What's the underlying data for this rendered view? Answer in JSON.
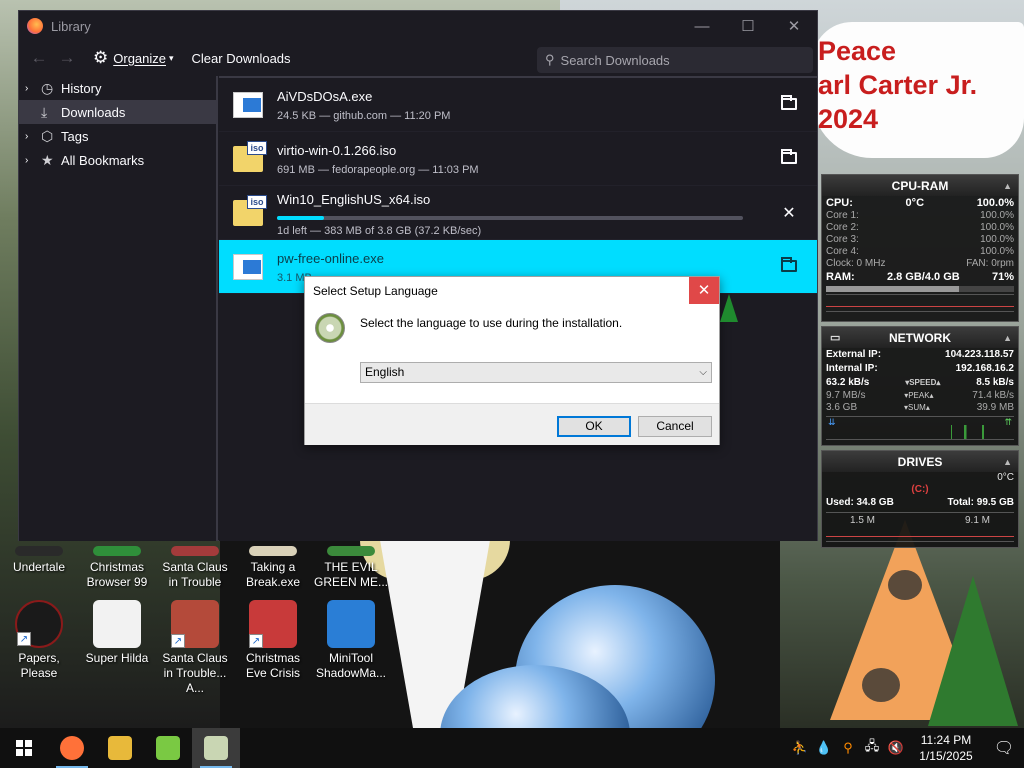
{
  "sticker": {
    "lines": [
      "Peace",
      "arl Carter Jr.",
      "2024"
    ]
  },
  "desktop_icons": [
    {
      "label": "Undertale",
      "color": "#2a2a2a",
      "shortcut": true
    },
    {
      "label": "Christmas Browser 99",
      "color": "#2f8f3a",
      "shortcut": true
    },
    {
      "label": "Santa Claus in Trouble",
      "color": "#a33b3b",
      "shortcut": true
    },
    {
      "label": "Taking a Break.exe",
      "color": "#d9d1b8",
      "shortcut": false
    },
    {
      "label": "THE EVIL GREEN ME...",
      "color": "#3b8a3b",
      "shortcut": true
    },
    {
      "label": "Papers, Please",
      "color": "#8a1a1a",
      "shortcut": true
    },
    {
      "label": "Super Hilda",
      "color": "#f2f2f2",
      "shortcut": false
    },
    {
      "label": "Santa Claus in Trouble... A...",
      "color": "#b44a3a",
      "shortcut": true
    },
    {
      "label": "Christmas Eve Crisis",
      "color": "#c83a3a",
      "shortcut": true
    },
    {
      "label": "MiniTool ShadowMa...",
      "color": "#2a7ed6",
      "shortcut": false
    }
  ],
  "library": {
    "title": "Library",
    "toolbar": {
      "back": "←",
      "forward": "→",
      "organize": "Organize",
      "clear": "Clear Downloads"
    },
    "search_placeholder": "Search Downloads",
    "sidebar": [
      {
        "label": "History",
        "twisty": "›",
        "icon": "◷"
      },
      {
        "label": "Downloads",
        "twisty": "",
        "icon": "⤓"
      },
      {
        "label": "Tags",
        "twisty": "›",
        "icon": "⬡"
      },
      {
        "label": "All Bookmarks",
        "twisty": "›",
        "icon": "★"
      }
    ],
    "downloads": [
      {
        "name": "AiVDsDOsA.exe",
        "status": "24.5 KB — github.com — 11:20 PM",
        "type": "exe"
      },
      {
        "name": "virtio-win-0.1.266.iso",
        "status": "691 MB — fedorapeople.org — 11:03 PM",
        "type": "iso"
      },
      {
        "name": "Win10_EnglishUS_x64.iso",
        "status": "1d left — 383 MB of 3.8 GB (37.2 KB/sec)",
        "type": "iso",
        "progress": 0.1
      },
      {
        "name": "pw-free-online.exe",
        "status": "3.1 MB",
        "type": "exe"
      }
    ]
  },
  "setup_dialog": {
    "title": "Select Setup Language",
    "close": "✕",
    "message": "Select the language to use during the installation.",
    "selected_language": "English",
    "ok": "OK",
    "cancel": "Cancel"
  },
  "gadgets": {
    "cpu_ram": {
      "title": "CPU-RAM",
      "cpu_label": "CPU:",
      "cpu_temp": "0°C",
      "cpu_value": "100.0%",
      "cores": [
        {
          "label": "Core 1:",
          "value": "100.0%"
        },
        {
          "label": "Core 2:",
          "value": "100.0%"
        },
        {
          "label": "Core 3:",
          "value": "100.0%"
        },
        {
          "label": "Core 4:",
          "value": "100.0%"
        }
      ],
      "clock": "Clock: 0 MHz",
      "fan": "FAN: 0rpm",
      "ram_label": "RAM:",
      "ram_value": "2.8 GB/4.0 GB",
      "ram_pct": "71%",
      "ram_fill": 0.71
    },
    "network": {
      "title": "NETWORK",
      "external_label": "External IP:",
      "external_ip": "104.223.118.57",
      "internal_label": "Internal IP:",
      "internal_ip": "192.168.16.2",
      "rows": [
        {
          "down": "63.2 kB/s",
          "label": "SPEED",
          "up": "8.5 kB/s"
        },
        {
          "down": "9.7 MB/s",
          "label": "PEAK",
          "up": "71.4 kB/s"
        },
        {
          "down": "3.6 GB",
          "label": "SUM",
          "up": "39.9 MB"
        }
      ]
    },
    "drives": {
      "title": "DRIVES",
      "temp": "0°C",
      "drive_letter": "(C:)",
      "used": "Used: 34.8 GB",
      "total": "Total: 99.5 GB",
      "read": "1.5 M",
      "write": "9.1 M"
    }
  },
  "taskbar": {
    "apps": [
      {
        "name": "firefox",
        "color": "#ff7139",
        "running": true,
        "active": false
      },
      {
        "name": "file-explorer",
        "color": "#e8b93a",
        "running": false,
        "active": false
      },
      {
        "name": "paint-app",
        "color": "#7ac943",
        "running": false,
        "active": false
      },
      {
        "name": "setup-app",
        "color": "#c9d6b3",
        "running": true,
        "active": true
      }
    ],
    "time": "11:24 PM",
    "date": "1/15/2025"
  }
}
